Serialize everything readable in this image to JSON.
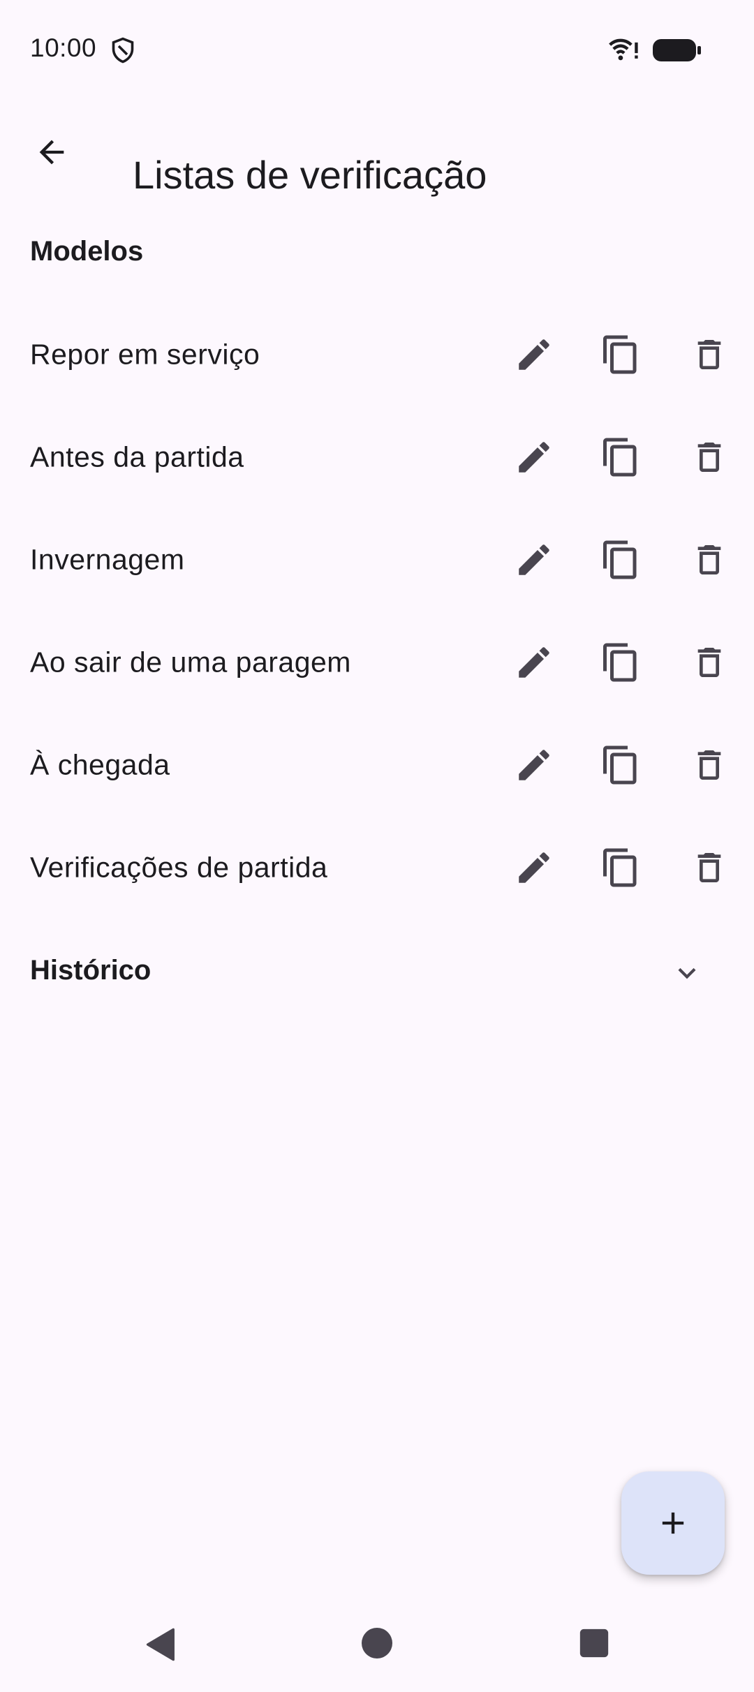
{
  "status_bar": {
    "time": "10:00"
  },
  "app_bar": {
    "title": "Listas de verificação"
  },
  "sections": {
    "templates_header": "Modelos",
    "history_header": "Histórico"
  },
  "templates": [
    {
      "label": "Repor em serviço"
    },
    {
      "label": "Antes da partida"
    },
    {
      "label": "Invernagem"
    },
    {
      "label": "Ao sair de uma paragem"
    },
    {
      "label": "À chegada"
    },
    {
      "label": "Verificações de partida"
    }
  ],
  "icons": {
    "back": "arrow-left-icon",
    "edit": "pencil-icon",
    "copy": "copy-icon",
    "delete": "trash-icon",
    "expand": "chevron-down-icon",
    "add": "plus-icon"
  },
  "colors": {
    "background": "#fdf8fe",
    "icon": "#49454f",
    "fab": "#dde3f9",
    "text": "#1c1b1f"
  }
}
